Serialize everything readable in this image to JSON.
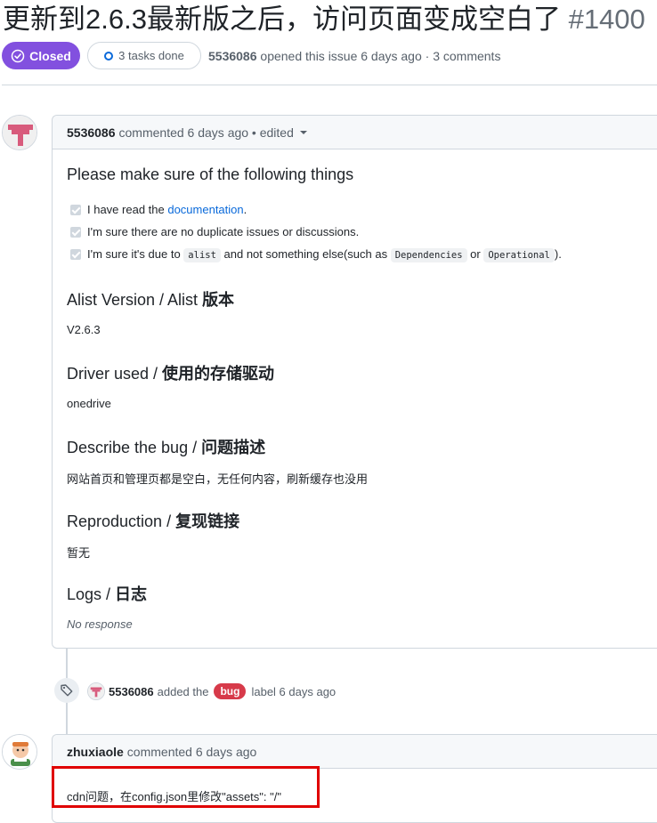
{
  "issue": {
    "title": "更新到2.6.3最新版之后，访问页面变成空白了",
    "number": "#1400",
    "state": "Closed",
    "tasks": "3 tasks done",
    "author": "5536086",
    "opened_text": "opened this issue 6 days ago · 3 comments"
  },
  "comment1": {
    "author": "5536086",
    "meta": "commented 6 days ago • edited",
    "checklist_heading": "Please make sure of the following things",
    "tasks": [
      {
        "prefix": "I have read the ",
        "link": "documentation",
        "suffix": "."
      },
      {
        "text": "I'm sure there are no duplicate issues or discussions."
      },
      {
        "prefix": "I'm sure it's due to ",
        "code1": "alist",
        "middle": " and not something else(such as ",
        "code2": "Dependencies",
        "or": " or ",
        "code3": "Operational",
        "suffix": ")."
      }
    ],
    "sections": [
      {
        "heading_en": "Alist Version / Alist ",
        "heading_zh": "版本",
        "body": "V2.6.3"
      },
      {
        "heading_en": "Driver used / ",
        "heading_zh": "使用的存储驱动",
        "body": "onedrive"
      },
      {
        "heading_en": "Describe the bug / ",
        "heading_zh": "问题描述",
        "body": "网站首页和管理页都是空白，无任何内容，刷新缓存也没用"
      },
      {
        "heading_en": "Reproduction / ",
        "heading_zh": "复现链接",
        "body": "暂无"
      },
      {
        "heading_en": "Logs / ",
        "heading_zh": "日志",
        "body": "No response"
      }
    ]
  },
  "event": {
    "author": "5536086",
    "action": "added the",
    "label": "bug",
    "suffix": "label 6 days ago"
  },
  "comment2": {
    "author": "zhuxiaole",
    "meta": "commented 6 days ago",
    "body": "cdn问题，在config.json里修改\"assets\": \"/\""
  },
  "colors": {
    "closed": "#8250df",
    "bug_label": "#d73a4a",
    "link": "#0969da",
    "highlight": "#e00000"
  }
}
